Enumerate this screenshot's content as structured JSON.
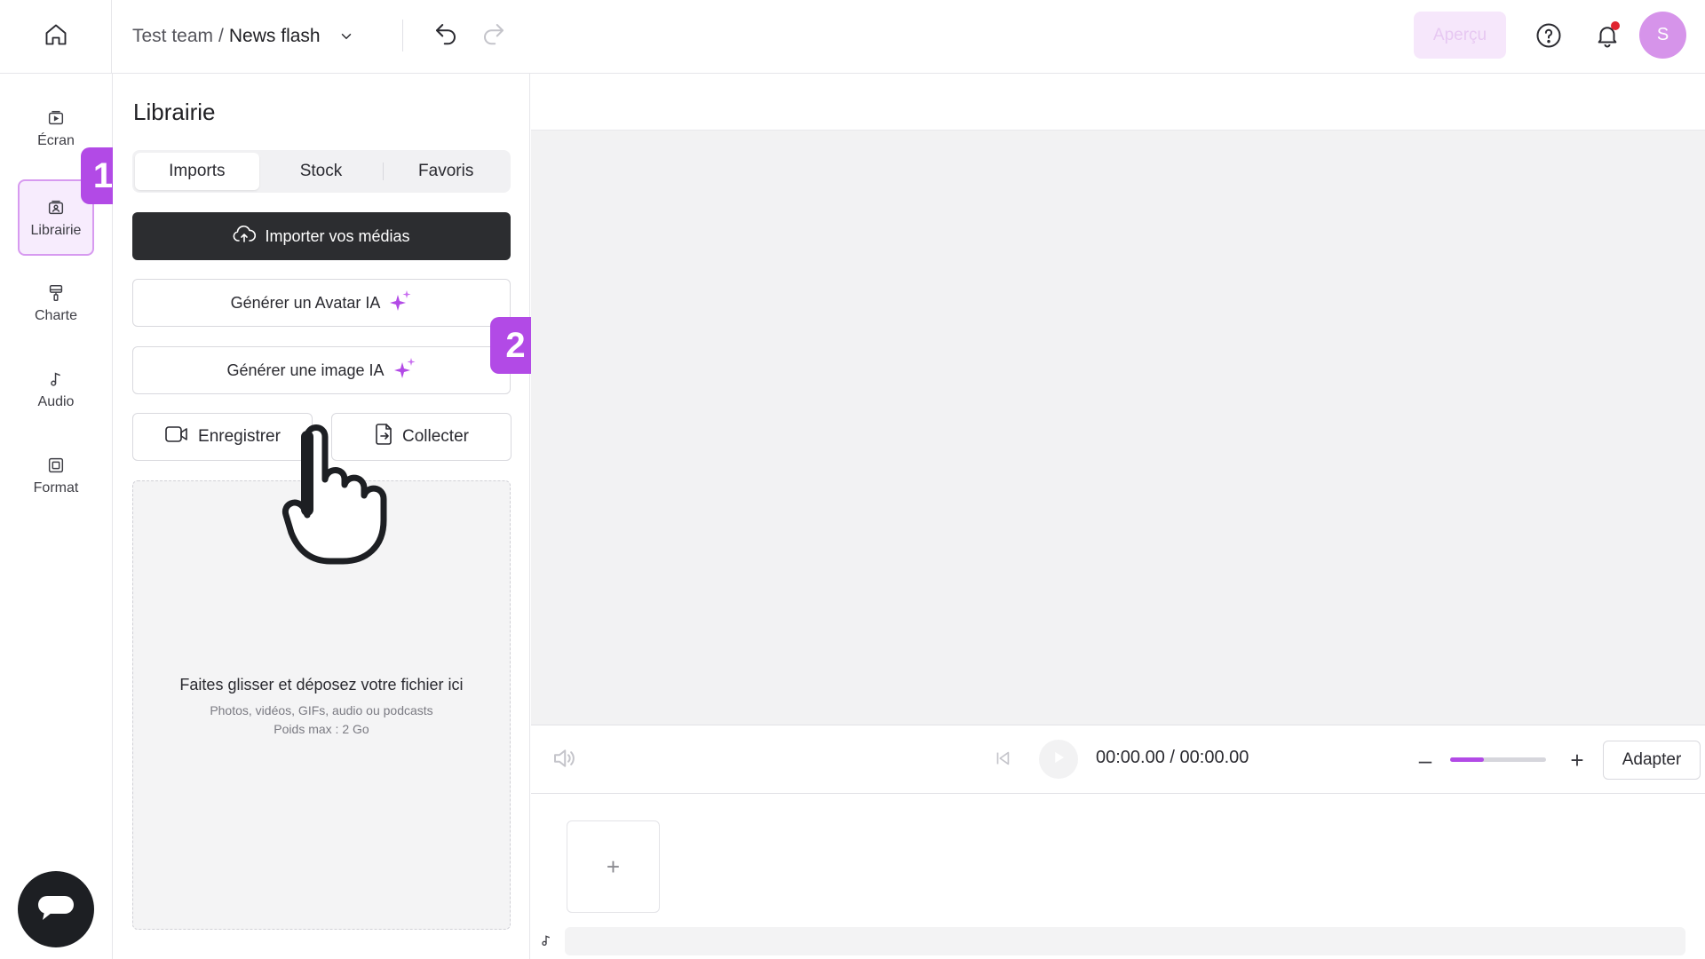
{
  "header": {
    "team": "Test team",
    "separator": "/",
    "project_name": "News flash",
    "preview_label": "Aperçu",
    "avatar_initial": "S",
    "icons": [
      "home-icon",
      "chevron-down-icon",
      "undo-icon",
      "redo-icon",
      "help-icon",
      "bell-icon"
    ],
    "notification_color": "#e0242f"
  },
  "sidebar": {
    "items": [
      {
        "label": "Écran",
        "icon": "screen-icon"
      },
      {
        "label": "Librairie",
        "icon": "library-icon",
        "active": true
      },
      {
        "label": "Charte",
        "icon": "brush-icon"
      },
      {
        "label": "Audio",
        "icon": "music-note-icon"
      },
      {
        "label": "Format",
        "icon": "format-icon"
      }
    ]
  },
  "badges": {
    "step1": "1",
    "step2": "2",
    "color": "#b24ae6"
  },
  "library": {
    "title": "Librairie",
    "tabs": [
      "Imports",
      "Stock",
      "Favoris"
    ],
    "active_tab": "Imports",
    "import_button": "Importer vos médias",
    "avatar_button": "Générer un Avatar IA",
    "image_button": "Générer une image IA",
    "record_button": "Enregistrer",
    "collect_button": "Collecter",
    "dropzone": {
      "title": "Faites glisser et déposez votre fichier ici",
      "subtitle": "Photos, vidéos, GIFs, audio ou podcasts",
      "max_size": "Poids max : 2 Go"
    }
  },
  "player": {
    "time": "00:00.00 / 00:00.00",
    "zoom_fraction": 0.35,
    "fit_label": "Adapter",
    "minus_label": "–",
    "plus_label": "+"
  },
  "timeline": {
    "add_label": "+"
  },
  "theme": {
    "accent": "#b24ae6",
    "dark_button": "#2c2d30",
    "sparkle": "#b24ae6"
  }
}
